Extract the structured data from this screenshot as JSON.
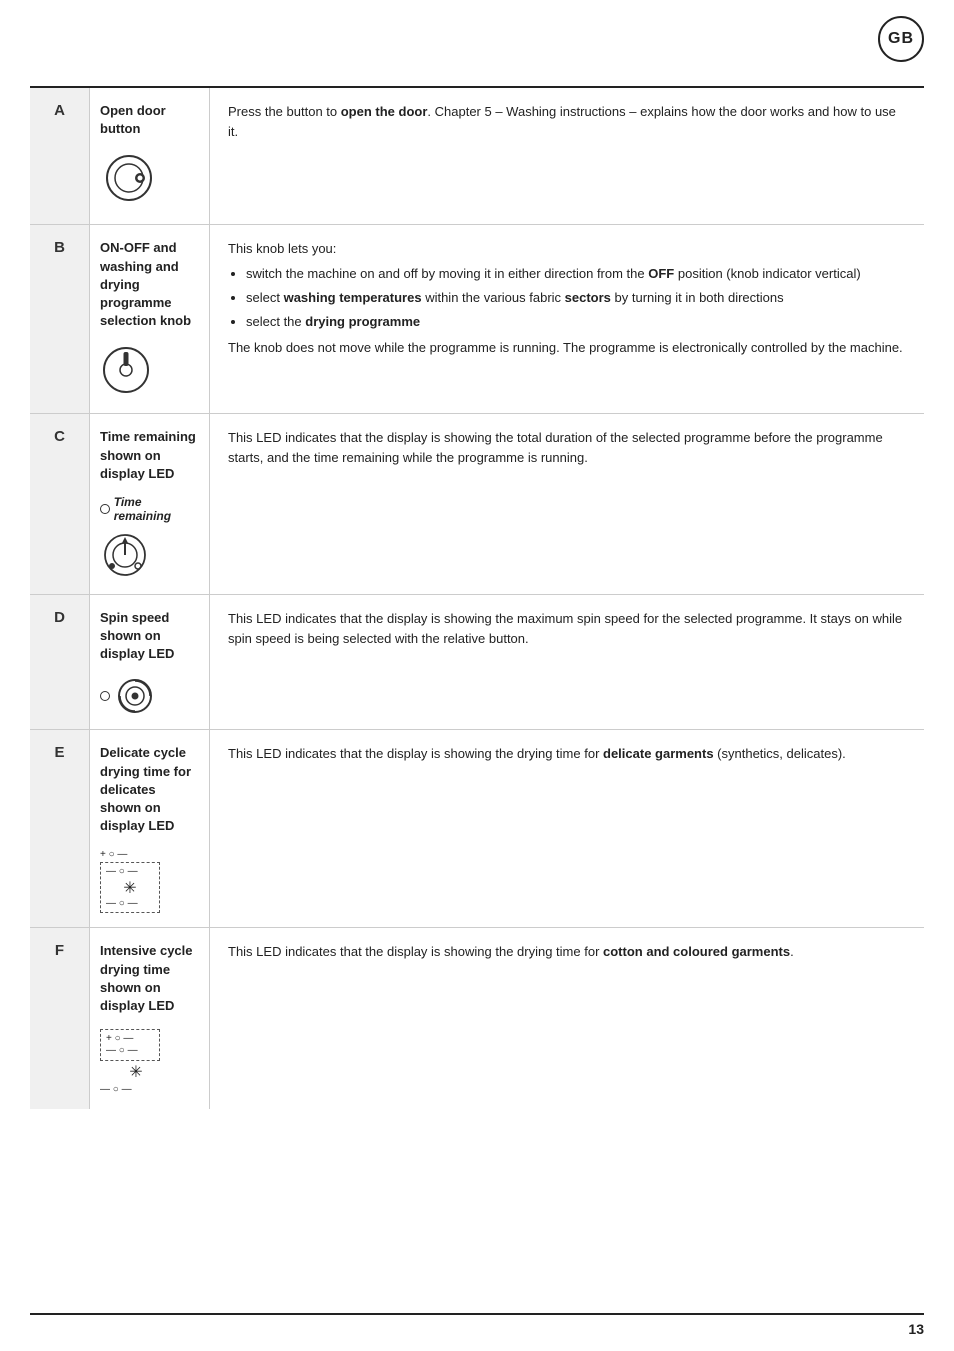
{
  "badge": "GB",
  "page_number": "13",
  "rows": [
    {
      "label": "A",
      "title": "Open door button",
      "icon_type": "open_door",
      "description_html": "Press the button to <b>open the door</b>. Chapter 5 – Washing instructions – explains how the door works and how to use it."
    },
    {
      "label": "B",
      "title": "ON-OFF and washing and drying programme selection knob",
      "icon_type": "knob",
      "description_html": "This knob lets you:<ul><li>switch the machine on and off by moving it in either direction from the <b>OFF</b> position (knob indicator vertical)</li><li>select <b>washing temperatures</b> within the various fabric <b>sectors</b> by turning it in both directions</li><li>select the <b>drying programme</b></li></ul>The knob does not move while the programme is running. The programme is electronically controlled by the machine."
    },
    {
      "label": "C",
      "title": "Time remaining shown on display LED",
      "subtitle": "Time remaining",
      "icon_type": "time_remaining",
      "description_html": "This LED indicates that the display is showing the total duration of the selected programme before the programme starts, and the time remaining while the programme is running."
    },
    {
      "label": "D",
      "title": "Spin speed shown on display LED",
      "icon_type": "spin_speed",
      "description_html": "This LED indicates that the display is showing the maximum spin speed for the selected programme. It stays on while spin speed is being selected with the relative button."
    },
    {
      "label": "E",
      "title": "Delicate cycle drying time for delicates shown on display LED",
      "icon_type": "delicate_drying",
      "description_html": "This LED indicates that the display is showing the drying time for <b>delicate garments</b> (synthetics, delicates)."
    },
    {
      "label": "F",
      "title": "Intensive cycle drying time shown on display LED",
      "icon_type": "intensive_drying",
      "description_html": "This LED indicates that the display is showing the drying time for <b>cotton and coloured garments</b>."
    }
  ]
}
